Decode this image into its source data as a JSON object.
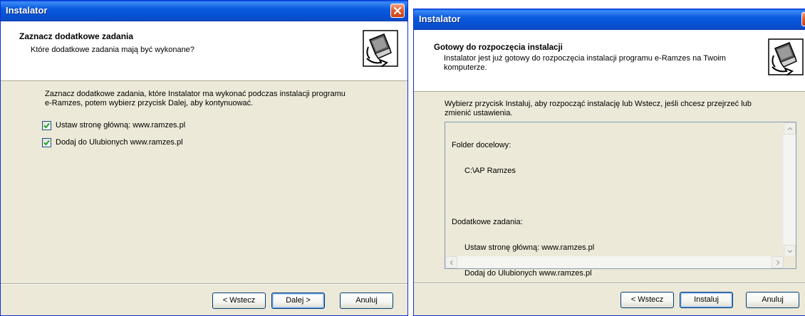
{
  "left_window": {
    "title": "Instalator",
    "header_title": "Zaznacz dodatkowe zadania",
    "header_subtitle": "Które dodatkowe zadania mają być wykonane?",
    "body_line1": "Zaznacz dodatkowe zadania, które Instalator ma wykonać podczas instalacji programu",
    "body_line2": "e-Ramzes, potem wybierz przycisk Dalej, aby kontynuować.",
    "checkboxes": [
      {
        "label": "Ustaw stronę główną: www.ramzes.pl",
        "checked": true
      },
      {
        "label": "Dodaj do Ulubionych www.ramzes.pl",
        "checked": true
      }
    ],
    "buttons": {
      "back": "< Wstecz",
      "next": "Dalej >",
      "cancel": "Anuluj"
    }
  },
  "right_window": {
    "title": "Instalator",
    "header_title": "Gotowy do rozpoczęcia instalacji",
    "header_subtitle_line1": "Instalator jest już gotowy do rozpoczęcia instalacji programu e-Ramzes na Twoim",
    "header_subtitle_line2": "komputerze.",
    "body_line1": "Wybierz przycisk Instaluj, aby rozpocząć instalację lub Wstecz, jeśli chcesz przejrzeć lub",
    "body_line2": "zmienić ustawienia.",
    "memo": {
      "folder_label": "Folder docelowy:",
      "folder_value": "C:\\AP Ramzes",
      "tasks_label": "Dodatkowe zadania:",
      "task1": "Ustaw stronę główną: www.ramzes.pl",
      "task2": "Dodaj do Ulubionych www.ramzes.pl"
    },
    "buttons": {
      "back": "< Wstecz",
      "install": "Instaluj",
      "cancel": "Anuluj"
    }
  },
  "icons": {
    "close": "close-icon",
    "installer": "installer-computer-icon",
    "check": "checkmark-icon"
  },
  "colors": {
    "titlebar": "#0a5fe0",
    "dialog_bg": "#ece9d8",
    "close_button": "#e35d2e",
    "check_green": "#21a121"
  }
}
